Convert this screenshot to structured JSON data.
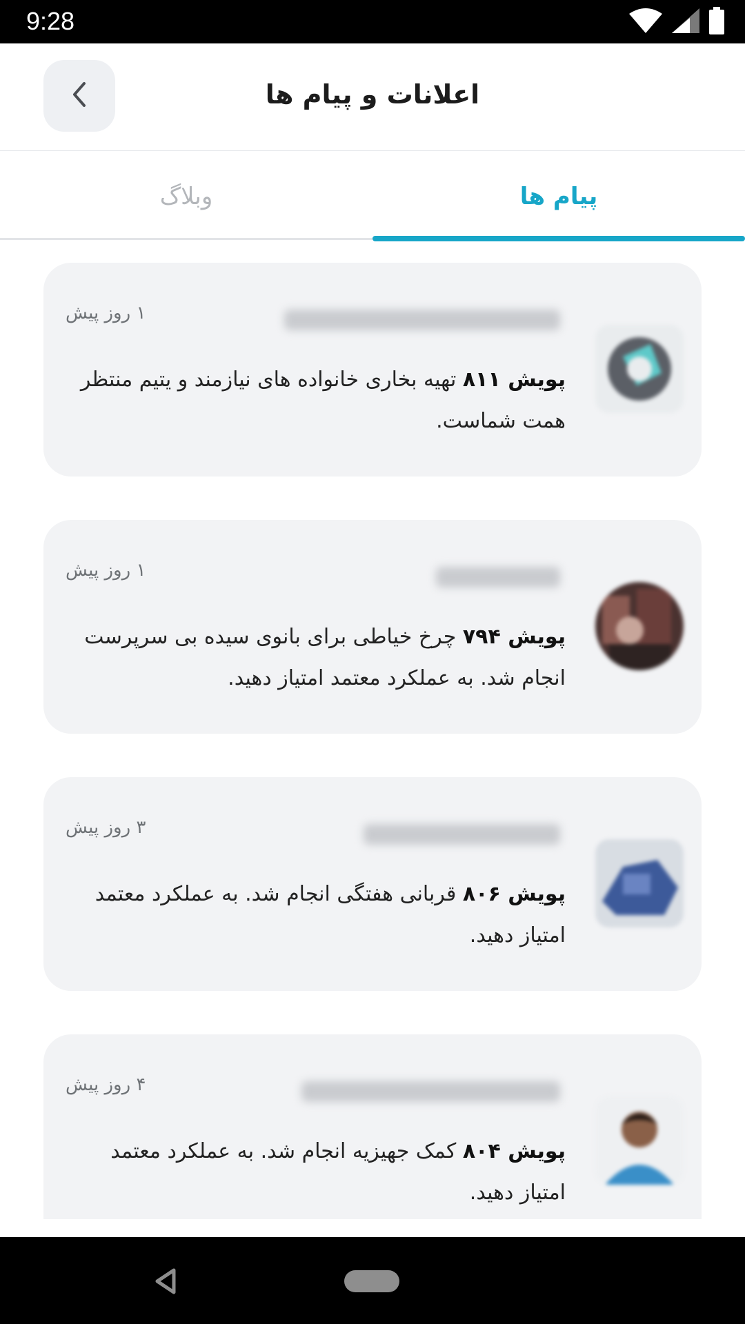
{
  "status_bar": {
    "time": "9:28",
    "icons": [
      "wifi-icon",
      "cellular-signal-icon",
      "battery-icon"
    ]
  },
  "header": {
    "title": "اعلانات و پیام ها",
    "back_icon": "chevron-left-icon"
  },
  "tabs": [
    {
      "label": "پیام ها",
      "active": true
    },
    {
      "label": "وبلاگ",
      "active": false
    }
  ],
  "colors": {
    "accent": "#17a6c8",
    "card_bg": "#f2f3f5",
    "inactive_tab": "#b3b6ba"
  },
  "messages": [
    {
      "time": "۱ روز پیش",
      "prefix": "پویش ۸۱۱",
      "text": "تهیه بخاری خانواده های نیازمند و یتیم منتظر همت شماست."
    },
    {
      "time": "۱ روز پیش",
      "prefix": "پویش ۷۹۴",
      "text": "چرخ خیاطی برای بانوی سیده بی سرپرست انجام شد. به عملکرد معتمد امتیاز دهید."
    },
    {
      "time": "۳ روز پیش",
      "prefix": "پویش ۸۰۶",
      "text": "قربانی هفتگی انجام شد. به عملکرد معتمد امتیاز دهید."
    },
    {
      "time": "۴ روز پیش",
      "prefix": "پویش ۸۰۴",
      "text": "کمک جهیزیه انجام شد. به عملکرد معتمد امتیاز دهید."
    }
  ],
  "nav_bar": {
    "icons": [
      "nav-back-icon",
      "nav-home-icon"
    ]
  }
}
